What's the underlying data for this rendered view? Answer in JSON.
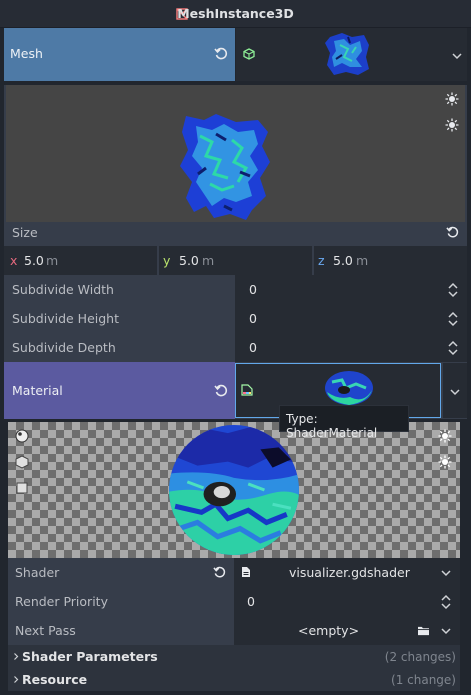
{
  "header": {
    "title": "MeshInstance3D"
  },
  "mesh": {
    "label": "Mesh"
  },
  "size": {
    "label": "Size",
    "x_axis": "x",
    "x_value": "5.0",
    "x_unit": "m",
    "y_axis": "y",
    "y_value": "5.0",
    "y_unit": "m",
    "z_axis": "z",
    "z_value": "5.0",
    "z_unit": "m"
  },
  "properties": [
    {
      "label": "Subdivide Width",
      "value": "0"
    },
    {
      "label": "Subdivide Height",
      "value": "0"
    },
    {
      "label": "Subdivide Depth",
      "value": "0"
    }
  ],
  "material": {
    "label": "Material",
    "tooltip": "Type: ShaderMaterial"
  },
  "shader": {
    "label": "Shader",
    "value": "visualizer.gdshader"
  },
  "render_priority": {
    "label": "Render Priority",
    "value": "0"
  },
  "next_pass": {
    "label": "Next Pass",
    "value": "<empty>"
  },
  "sections": [
    {
      "label": "Shader Parameters",
      "changes": "(2 changes)"
    },
    {
      "label": "Resource",
      "changes": "(1 change)"
    }
  ],
  "colors": {
    "mesh_highlight": "#4e7aa6",
    "material_highlight": "#5b5aa0",
    "accent_blue": "#62a8ea"
  }
}
